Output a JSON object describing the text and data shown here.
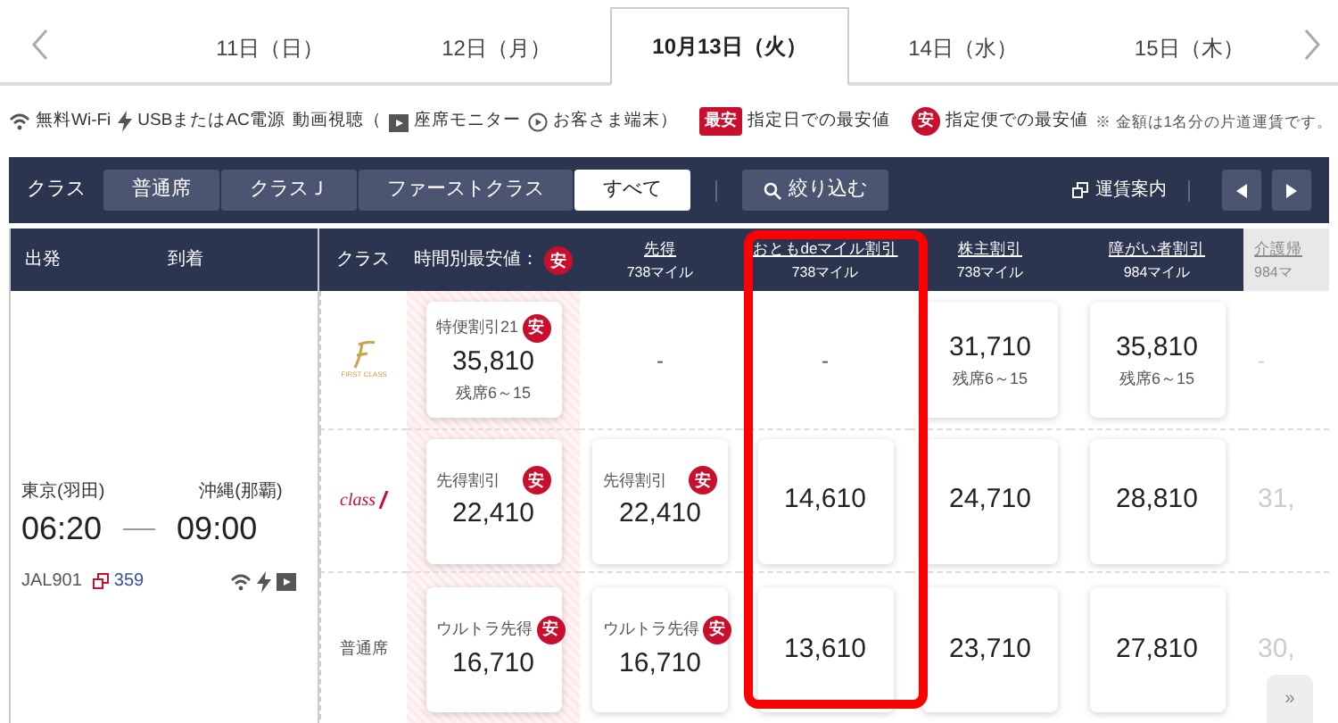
{
  "dates": [
    {
      "label": "11日（日）",
      "selected": false
    },
    {
      "label": "12日（月）",
      "selected": false
    },
    {
      "label": "10月13日（火）",
      "selected": true
    },
    {
      "label": "14日（水）",
      "selected": false
    },
    {
      "label": "15日（木）",
      "selected": false
    }
  ],
  "legend": [
    {
      "kind": "wifi",
      "text": "無料Wi-Fi"
    },
    {
      "kind": "power",
      "text": "USBまたはAC電源"
    },
    {
      "kind": "plain",
      "text": "動画視聴（"
    },
    {
      "kind": "monitor",
      "text": "座席モニター"
    },
    {
      "kind": "device",
      "text": "お客さま端末）"
    },
    {
      "kind": "day-badge",
      "badge": "最安",
      "text": "指定日での最安値"
    },
    {
      "kind": "flight-badge",
      "badge": "安",
      "text": "指定便での最安値"
    }
  ],
  "note": "※ 金額は1名分の片道運賃です。",
  "toolbar": {
    "label": "クラス",
    "classes": [
      {
        "label": "普通席",
        "selected": false
      },
      {
        "label": "クラスＪ",
        "selected": false
      },
      {
        "label": "ファーストクラス",
        "selected": false
      },
      {
        "label": "すべて",
        "selected": true
      }
    ],
    "filter": "絞り込む",
    "fare_info": "運賃案内"
  },
  "header": {
    "departure": "出発",
    "arrival": "到着",
    "class": "クラス",
    "best": "時間別最安値：",
    "best_badge": "安",
    "fares": [
      {
        "name": "先得",
        "miles": "738マイル",
        "faded": false
      },
      {
        "name": "おともdeマイル割引",
        "miles": "738マイル",
        "faded": false
      },
      {
        "name": "株主割引",
        "miles": "738マイル",
        "faded": false
      },
      {
        "name": "障がい者割引",
        "miles": "984マイル",
        "faded": false
      },
      {
        "name": "介護帰",
        "miles": "984マ",
        "faded": true
      }
    ]
  },
  "flight": {
    "from": "東京(羽田)",
    "to": "沖縄(那覇)",
    "departs": "06:20",
    "arrives": "09:00",
    "number": "JAL901",
    "codeshare": "359"
  },
  "rows": [
    {
      "kind": "first",
      "logo": "FIRST CLASS",
      "cells": [
        {
          "kind": "card",
          "fare": "特便割引21",
          "badge": "安",
          "price": "35,810",
          "seats": "残席6～15"
        },
        {
          "kind": "dash",
          "text": "-"
        },
        {
          "kind": "dash",
          "text": "-"
        },
        {
          "kind": "card",
          "price": "31,710",
          "seats": "残席6～15"
        },
        {
          "kind": "card",
          "price": "35,810",
          "seats": "残席6～15"
        },
        {
          "kind": "dash",
          "text": "-"
        }
      ]
    },
    {
      "kind": "classj",
      "logo": "class",
      "cells": [
        {
          "kind": "card",
          "fare": "先得割引",
          "badge": "安",
          "price": "22,410"
        },
        {
          "kind": "card",
          "fare": "先得割引",
          "badge": "安",
          "price": "22,410"
        },
        {
          "kind": "card",
          "price": "14,610"
        },
        {
          "kind": "card",
          "price": "24,710"
        },
        {
          "kind": "card",
          "price": "28,810"
        },
        {
          "kind": "faded",
          "price": "31,"
        }
      ]
    },
    {
      "kind": "text",
      "logo": "普通席",
      "cells": [
        {
          "kind": "card",
          "fare": "ウルトラ先得",
          "badge": "安",
          "price": "16,710"
        },
        {
          "kind": "card",
          "fare": "ウルトラ先得",
          "badge": "安",
          "price": "16,710"
        },
        {
          "kind": "card",
          "price": "13,610"
        },
        {
          "kind": "card",
          "price": "23,710"
        },
        {
          "kind": "card",
          "price": "27,810"
        },
        {
          "kind": "faded",
          "price": "30,"
        }
      ]
    }
  ],
  "more": "»"
}
